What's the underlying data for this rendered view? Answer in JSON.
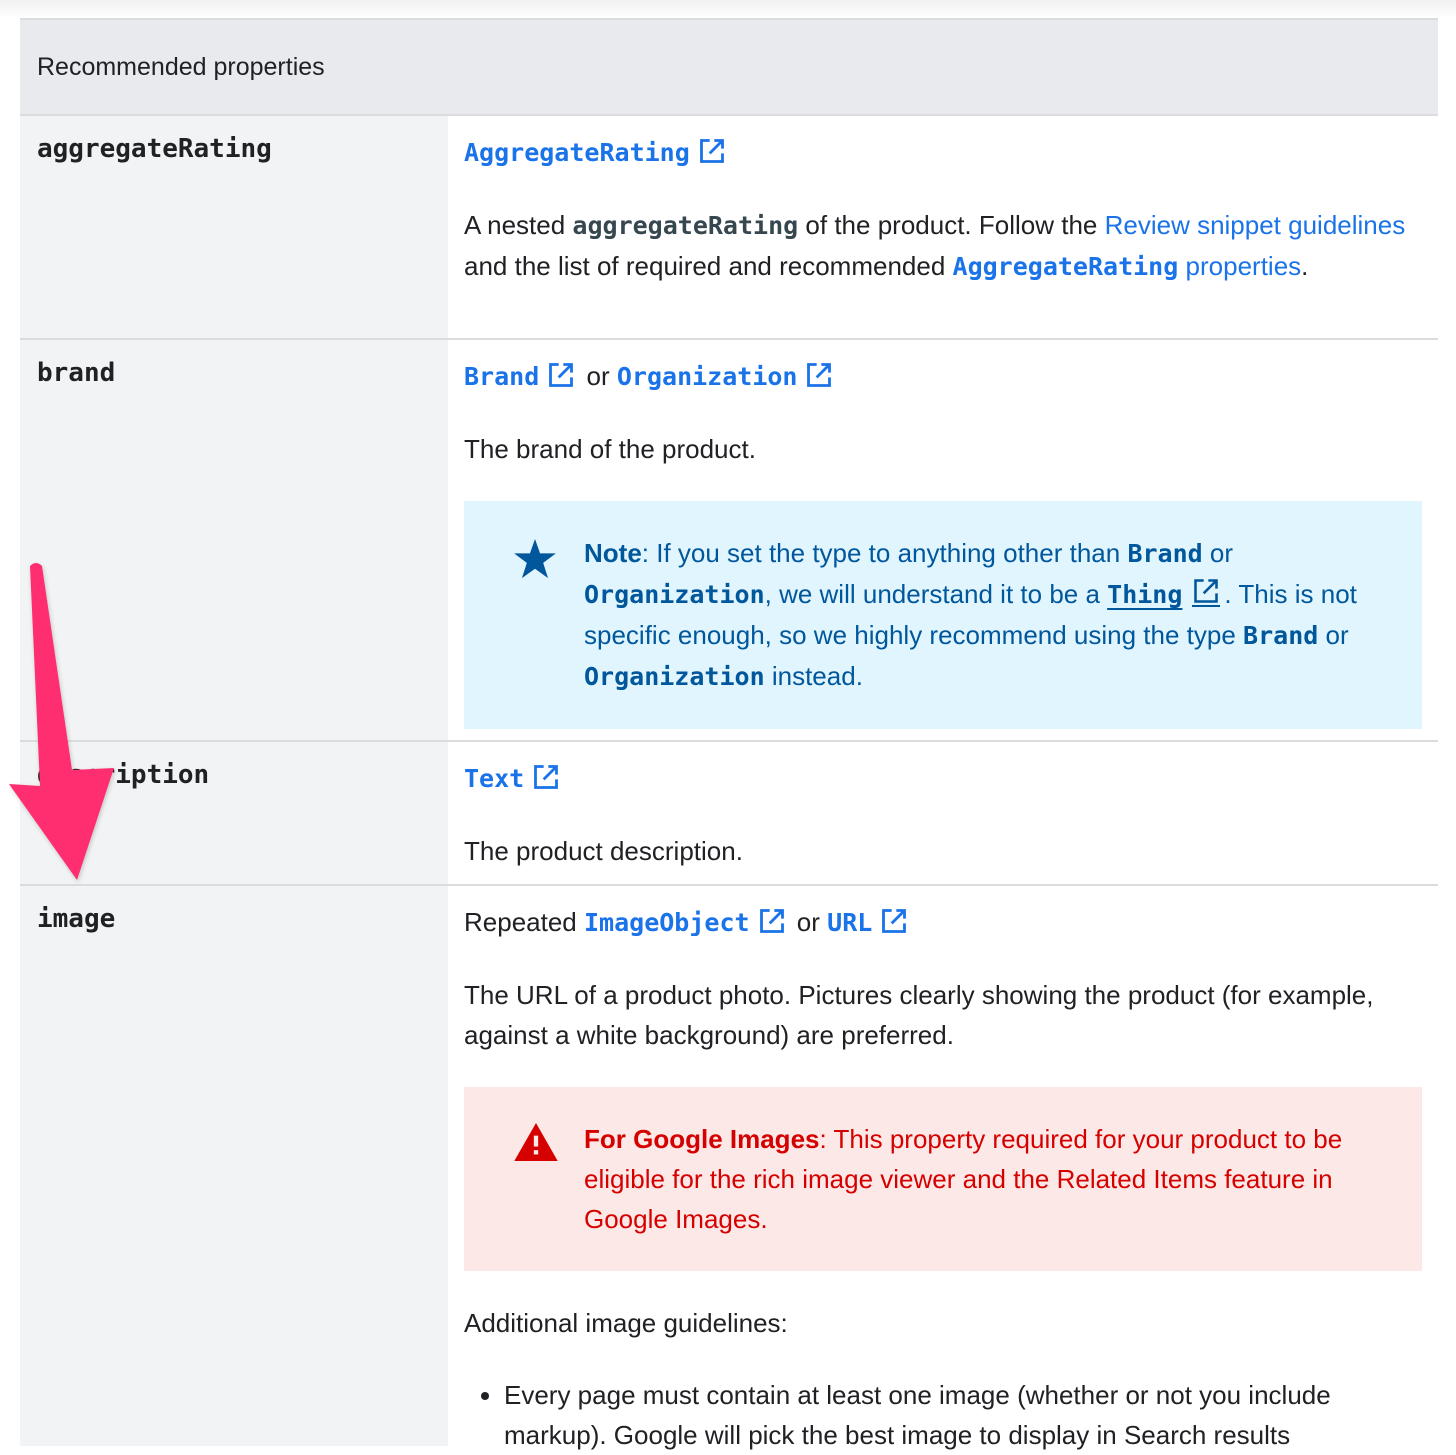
{
  "table": {
    "header": "Recommended properties",
    "rows": [
      {
        "name": "aggregateRating",
        "type_links": [
          "AggregateRating"
        ],
        "desc": {
          "p1": "A nested ",
          "code1": "aggregateRating",
          "p2": " of the product. Follow the ",
          "link1": "Review snippet guidelines",
          "p3": " and the list of required and recommended ",
          "code_link": "AggregateRating",
          "link2": "properties",
          "p4": "."
        }
      },
      {
        "name": "brand",
        "type_links": [
          "Brand",
          "Organization"
        ],
        "or": "or",
        "desc": "The brand of the product.",
        "note": {
          "label": "Note",
          "t1": ": If you set the type to anything other than ",
          "c1": "Brand",
          "t2": " or ",
          "c2": "Organization",
          "t3": ", we will understand it to be a ",
          "c3": "Thing",
          "t4": ". This is not specific enough, so we highly recommend using the type ",
          "c4": "Brand",
          "t5": " or ",
          "c5": "Organization",
          "t6": " instead.",
          "icon": "star-icon",
          "color": "#01579b",
          "bg": "#e1f5fe"
        }
      },
      {
        "name": "description",
        "type_links": [
          "Text"
        ],
        "desc": "The product description."
      },
      {
        "name": "image",
        "prefix": "Repeated ",
        "type_links": [
          "ImageObject",
          "URL"
        ],
        "or": "or",
        "desc": "The URL of a product photo. Pictures clearly showing the product (for example, against a white background) are preferred.",
        "warning": {
          "label": "For Google Images",
          "text": ": This property required for your product to be eligible for the rich image viewer and the Related Items feature in Google Images.",
          "icon": "warning-icon",
          "color": "#d50000",
          "bg": "#fce8e6"
        },
        "additional": "Additional image guidelines:",
        "bullets": [
          "Every page must contain at least one image (whether or not you include markup). Google will pick the best image to display in Search results"
        ]
      }
    ]
  },
  "colors": {
    "link": "#1a73e8",
    "header_bg": "#e8eaed",
    "name_col_bg": "#f1f3f4",
    "annotation_arrow": "#ff2d6f"
  }
}
